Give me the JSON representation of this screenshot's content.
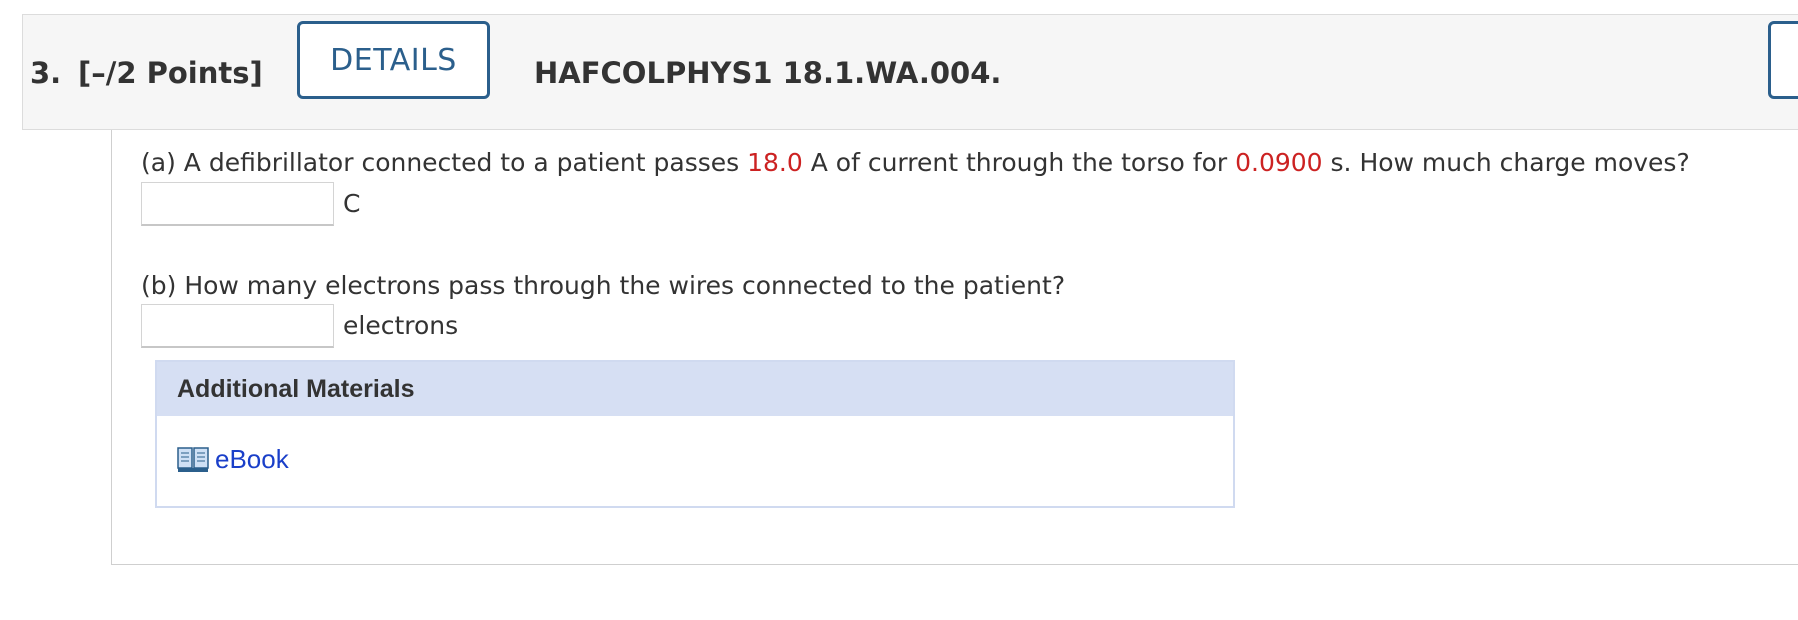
{
  "header": {
    "number": "3.",
    "points": "[–/2 Points]",
    "details_label": "DETAILS",
    "problem_id": "HAFCOLPHYS1 18.1.WA.004."
  },
  "parts": {
    "a": {
      "text_before": "(a) A defibrillator connected to a patient passes ",
      "value1": "18.0",
      "text_middle": " A of current through the torso for ",
      "value2": "0.0900",
      "text_after": " s. How much charge moves?",
      "input_value": "",
      "unit": "C"
    },
    "b": {
      "text": "(b) How many electrons pass through the wires connected to the patient?",
      "input_value": "",
      "unit": "electrons"
    }
  },
  "materials": {
    "title": "Additional Materials",
    "ebook_label": "eBook",
    "ebook_icon": "open-book-icon"
  },
  "colors": {
    "accent": "#2b5f8c",
    "highlight": "#cc2222",
    "link": "#1a3fc9",
    "materials_header_bg": "#d6dff3"
  }
}
